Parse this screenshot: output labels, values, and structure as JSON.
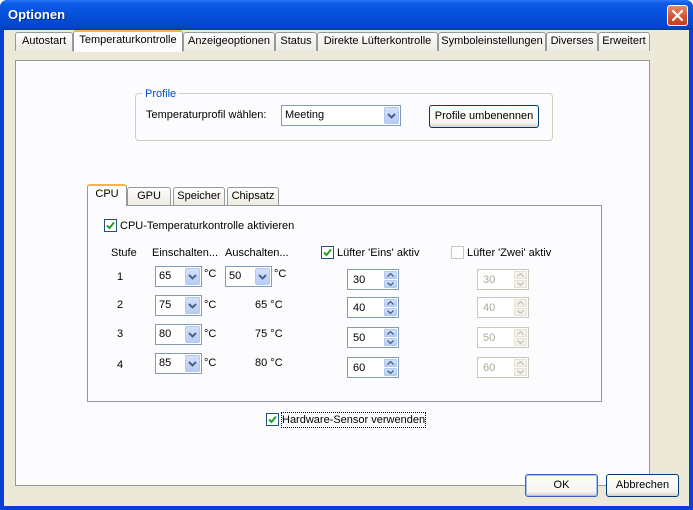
{
  "window": {
    "title": "Optionen"
  },
  "tabs": [
    "Autostart",
    "Temperaturkontrolle",
    "Anzeigeoptionen",
    "Status",
    "Direkte Lüfterkontrolle",
    "Symboleinstellungen",
    "Diverses",
    "Erweitert"
  ],
  "active_tab": "Temperaturkontrolle",
  "profile": {
    "group_label": "Profile",
    "select_label": "Temperaturprofil wählen:",
    "selected": "Meeting",
    "rename_button": "Profile umbenennen"
  },
  "inner_tabs": [
    "CPU",
    "GPU",
    "Speicher",
    "Chipsatz"
  ],
  "active_inner_tab": "CPU",
  "cpu": {
    "enable_label": "CPU-Temperaturkontrolle aktivieren",
    "enable_checked": true,
    "col_stage": "Stufe",
    "col_on": "Einschalten...",
    "col_off": "Auschalten...",
    "fan1_label": "Lüfter 'Eins' aktiv",
    "fan1_checked": true,
    "fan2_label": "Lüfter 'Zwei' aktiv",
    "fan2_checked": false,
    "unit": "°C",
    "rows": [
      {
        "stage": "1",
        "on": "65",
        "off": "50",
        "fan1": "30",
        "fan2": "30"
      },
      {
        "stage": "2",
        "on": "75",
        "off": "65 °C",
        "fan1": "40",
        "fan2": "40"
      },
      {
        "stage": "3",
        "on": "80",
        "off": "75 °C",
        "fan1": "50",
        "fan2": "50"
      },
      {
        "stage": "4",
        "on": "85",
        "off": "80 °C",
        "fan1": "60",
        "fan2": "60"
      }
    ]
  },
  "hardware_sensor": {
    "label": "Hardware-Sensor verwenden",
    "checked": true
  },
  "buttons": {
    "ok": "OK",
    "cancel": "Abbrechen"
  },
  "colors": {
    "titlebar": "#0651dc",
    "accent_tab": "#f7b348",
    "groupbox_label": "#0046d5"
  }
}
